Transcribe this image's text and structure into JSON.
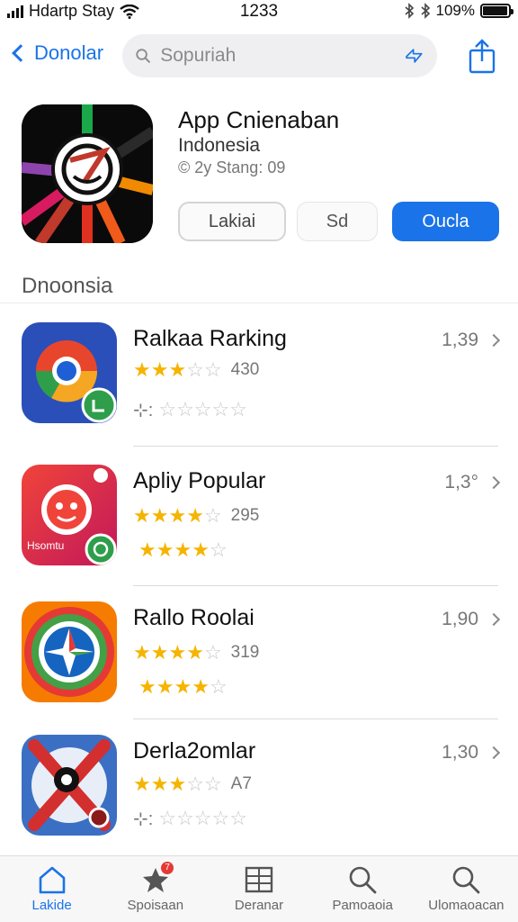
{
  "status_bar": {
    "carrier": "Hdartp Stay",
    "time": "1233",
    "battery": "109%",
    "battery_level": 0.95,
    "icons": [
      "signal-icon",
      "wifi-icon",
      "bluetooth-icon",
      "battery-icon"
    ]
  },
  "nav": {
    "back_label": "Donolar",
    "search_placeholder": "Sopuriah"
  },
  "app": {
    "title": "App Cnienaban",
    "subtitle": "Indonesia",
    "meta": "© 2y Stang: 09",
    "buttons": {
      "like": "Lakiai",
      "sd": "Sd",
      "get": "Oucla"
    }
  },
  "section": {
    "title": "Dnoonsia"
  },
  "list": [
    {
      "name": "Ralkaa Rarking",
      "value": "1,39",
      "rating": 2.5,
      "count": "430",
      "sub_prefix": "⊹:",
      "sub_rating": 0
    },
    {
      "name": "Apliy Popular",
      "value": "1,3°",
      "rating": 4,
      "count": "295",
      "sub_prefix": "",
      "sub_rating": 3.5
    },
    {
      "name": "Rallo Roolai",
      "value": "1,90",
      "rating": 4,
      "count": "319",
      "sub_prefix": "",
      "sub_rating": 4
    },
    {
      "name": "Derla2omlar",
      "value": "1,30",
      "rating": 3,
      "count": "A7",
      "sub_prefix": "⊹:",
      "sub_rating": 0
    }
  ],
  "tabs": [
    {
      "label": "Lakide",
      "icon": "home-icon",
      "active": true
    },
    {
      "label": "Spoisaan",
      "icon": "star-icon",
      "active": false,
      "badge": "7"
    },
    {
      "label": "Deranar",
      "icon": "grid-icon",
      "active": false
    },
    {
      "label": "Pamoaoia",
      "icon": "search-icon",
      "active": false
    },
    {
      "label": "Ulomaoacan",
      "icon": "search-icon",
      "active": false
    }
  ],
  "colors": {
    "accent": "#1a73e8",
    "star": "#f5b400",
    "badge": "#e53935"
  }
}
